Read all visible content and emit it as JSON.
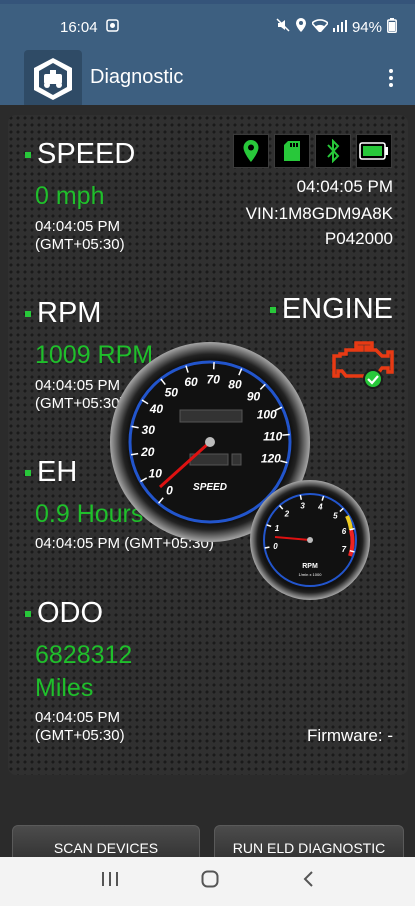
{
  "status_bar": {
    "time": "16:04",
    "battery": "94%"
  },
  "app_bar": {
    "title": "Diagnostic"
  },
  "speed": {
    "label": "SPEED",
    "value": "0 mph",
    "time": "04:04:05 PM",
    "tz": "(GMT+05:30)"
  },
  "device": {
    "time": "04:04:05 PM",
    "vin": "VIN:1M8GDM9A8K",
    "code": "P042000"
  },
  "rpm": {
    "label": "RPM",
    "value": "1009 RPM",
    "time": "04:04:05 PM",
    "tz": "(GMT+05:30)"
  },
  "engine": {
    "label": "ENGINE"
  },
  "eh": {
    "label": "EH",
    "value": "0.9 Hours",
    "timestamp": "04:04:05 PM (GMT+05:30)"
  },
  "odo": {
    "label": "ODO",
    "value_line1": "6828312",
    "value_line2": "Miles",
    "time": "04:04:05 PM",
    "tz": "(GMT+05:30)"
  },
  "firmware": "Firmware: -",
  "speedometer": {
    "ticks": [
      "0",
      "10",
      "20",
      "30",
      "40",
      "50",
      "60",
      "70",
      "80",
      "90",
      "100",
      "110",
      "120"
    ],
    "caption": "SPEED"
  },
  "tachometer": {
    "ticks": [
      "0",
      "1",
      "2",
      "3",
      "4",
      "5",
      "6",
      "7"
    ],
    "caption": "RPM",
    "sub_caption": "1/min x 1000"
  },
  "buttons": {
    "scan": "SCAN DEVICES",
    "run": "RUN ELD DIAGNOSTIC"
  },
  "colors": {
    "accent": "#3d5f80",
    "value_green": "#1fbf2b",
    "icon_green": "#28c83a"
  }
}
